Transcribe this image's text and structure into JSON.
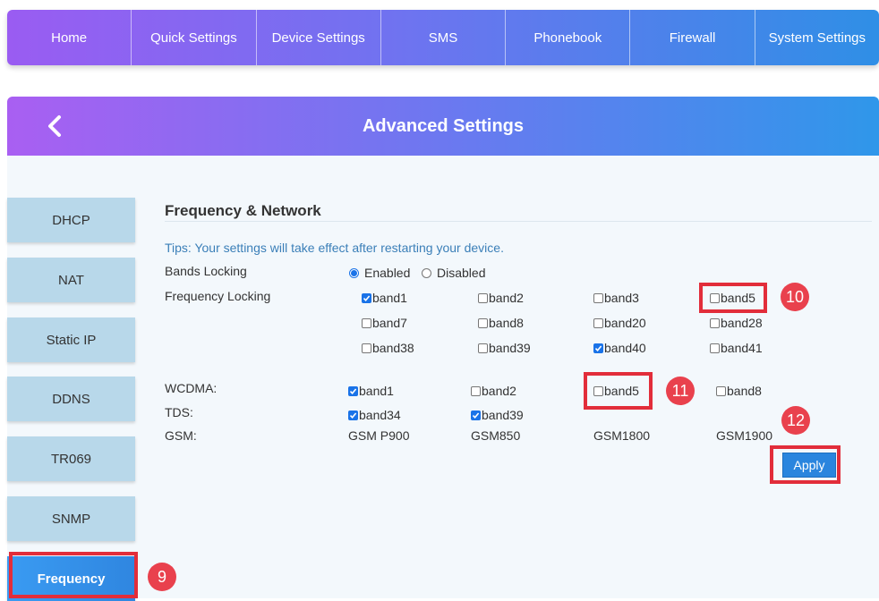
{
  "nav": [
    "Home",
    "Quick Settings",
    "Device Settings",
    "SMS",
    "Phonebook",
    "Firewall",
    "System Settings"
  ],
  "header": {
    "title": "Advanced Settings"
  },
  "sidebar": [
    "DHCP",
    "NAT",
    "Static IP",
    "DDNS",
    "TR069",
    "SNMP",
    "Frequency"
  ],
  "section": {
    "title": "Frequency & Network",
    "tips": "Tips: Your settings will take effect after restarting your device.",
    "bands_locking_label": "Bands Locking",
    "enabled": "Enabled",
    "disabled": "Disabled",
    "freq_locking_label": "Frequency Locking",
    "lte_bands": [
      {
        "label": "band1",
        "checked": true
      },
      {
        "label": "band2",
        "checked": false
      },
      {
        "label": "band3",
        "checked": false
      },
      {
        "label": "band5",
        "checked": false
      },
      {
        "label": "band7",
        "checked": false
      },
      {
        "label": "band8",
        "checked": false
      },
      {
        "label": "band20",
        "checked": false
      },
      {
        "label": "band28",
        "checked": false
      },
      {
        "label": "band38",
        "checked": false
      },
      {
        "label": "band39",
        "checked": false
      },
      {
        "label": "band40",
        "checked": true
      },
      {
        "label": "band41",
        "checked": false
      }
    ],
    "wcdma_label": "WCDMA:",
    "wcdma_bands": [
      {
        "label": "band1",
        "checked": true
      },
      {
        "label": "band2",
        "checked": false
      },
      {
        "label": "band5",
        "checked": false
      },
      {
        "label": "band8",
        "checked": false
      }
    ],
    "tds_label": "TDS:",
    "tds_bands": [
      {
        "label": "band34",
        "checked": true
      },
      {
        "label": "band39",
        "checked": true
      }
    ],
    "gsm_label": "GSM:",
    "gsm_bands": [
      "GSM P900",
      "GSM850",
      "GSM1800",
      "GSM1900"
    ],
    "apply_label": "Apply"
  },
  "badges": [
    "9",
    "10",
    "11",
    "12"
  ],
  "colors": {
    "accent": "#2a85de",
    "highlight": "#e22d3a",
    "badge": "#e9414d"
  }
}
